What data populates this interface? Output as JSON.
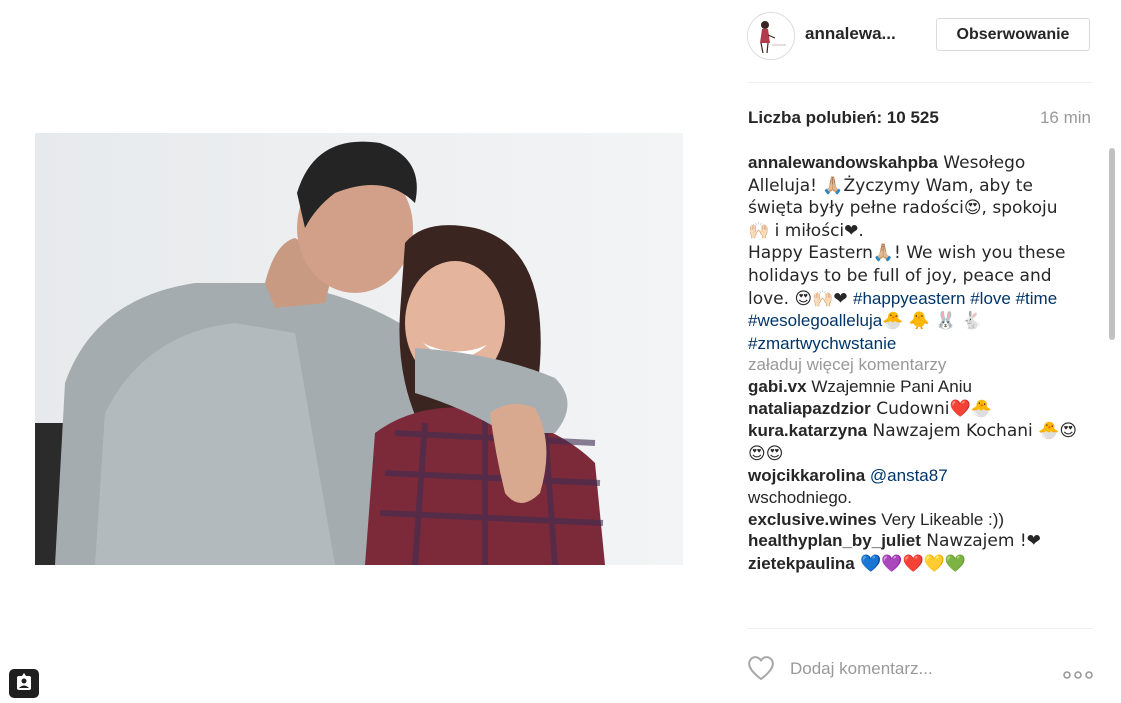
{
  "post": {
    "username": "annalewa...",
    "follow_label": "Obserwowanie",
    "likes_text": "Liczba polubień: 10 525",
    "time_ago": "16 min",
    "caption": {
      "author": "annalewandowskahpba",
      "text_1": " Wesołego Alleluja! 🙏🏼Życzymy Wam, aby te święta były pełne radości😍, spokoju 🙌🏻 i miłości❤.",
      "text_2": "Happy Eastern🙏🏼! We wish you these holidays to be full of joy, peace and love. 😍🙌🏻❤ ",
      "hashtags": [
        "#happyeastern",
        "#love",
        "#time",
        "#wesolegoalleluja",
        "#zmartwychwstanie"
      ],
      "emoji_after_hashtags": "🐣 🐥 🐰",
      "emoji_before_last": "🐇"
    },
    "load_more_label": "załaduj więcej komentarzy",
    "comments": [
      {
        "author": "gabi.vx",
        "text": " Wzajemnie Pani Aniu"
      },
      {
        "author": "nataliapazdzior",
        "text": " Cudowni❤️🐣"
      },
      {
        "author": "kura.katarzyna",
        "text": " Nawzajem Kochani 🐣😍😍😍"
      },
      {
        "author": "wojcikkarolina",
        "mention": "@ansta87",
        "text": " wschodniego."
      },
      {
        "author": "exclusive.wines",
        "text": " Very Likeable :))"
      },
      {
        "author": "healthyplan_by_juliet",
        "text": " Nawzajem !❤"
      },
      {
        "author": "zietekpaulina",
        "text": " 💙💜❤️💛💚"
      }
    ],
    "add_comment_placeholder": "Dodaj komentarz...",
    "icons": {
      "heart": "heart-icon",
      "more": "more-options-icon",
      "tag": "tag-user-icon"
    }
  },
  "colors": {
    "link": "#003569",
    "muted": "#999999",
    "border": "#dbdbdb"
  }
}
